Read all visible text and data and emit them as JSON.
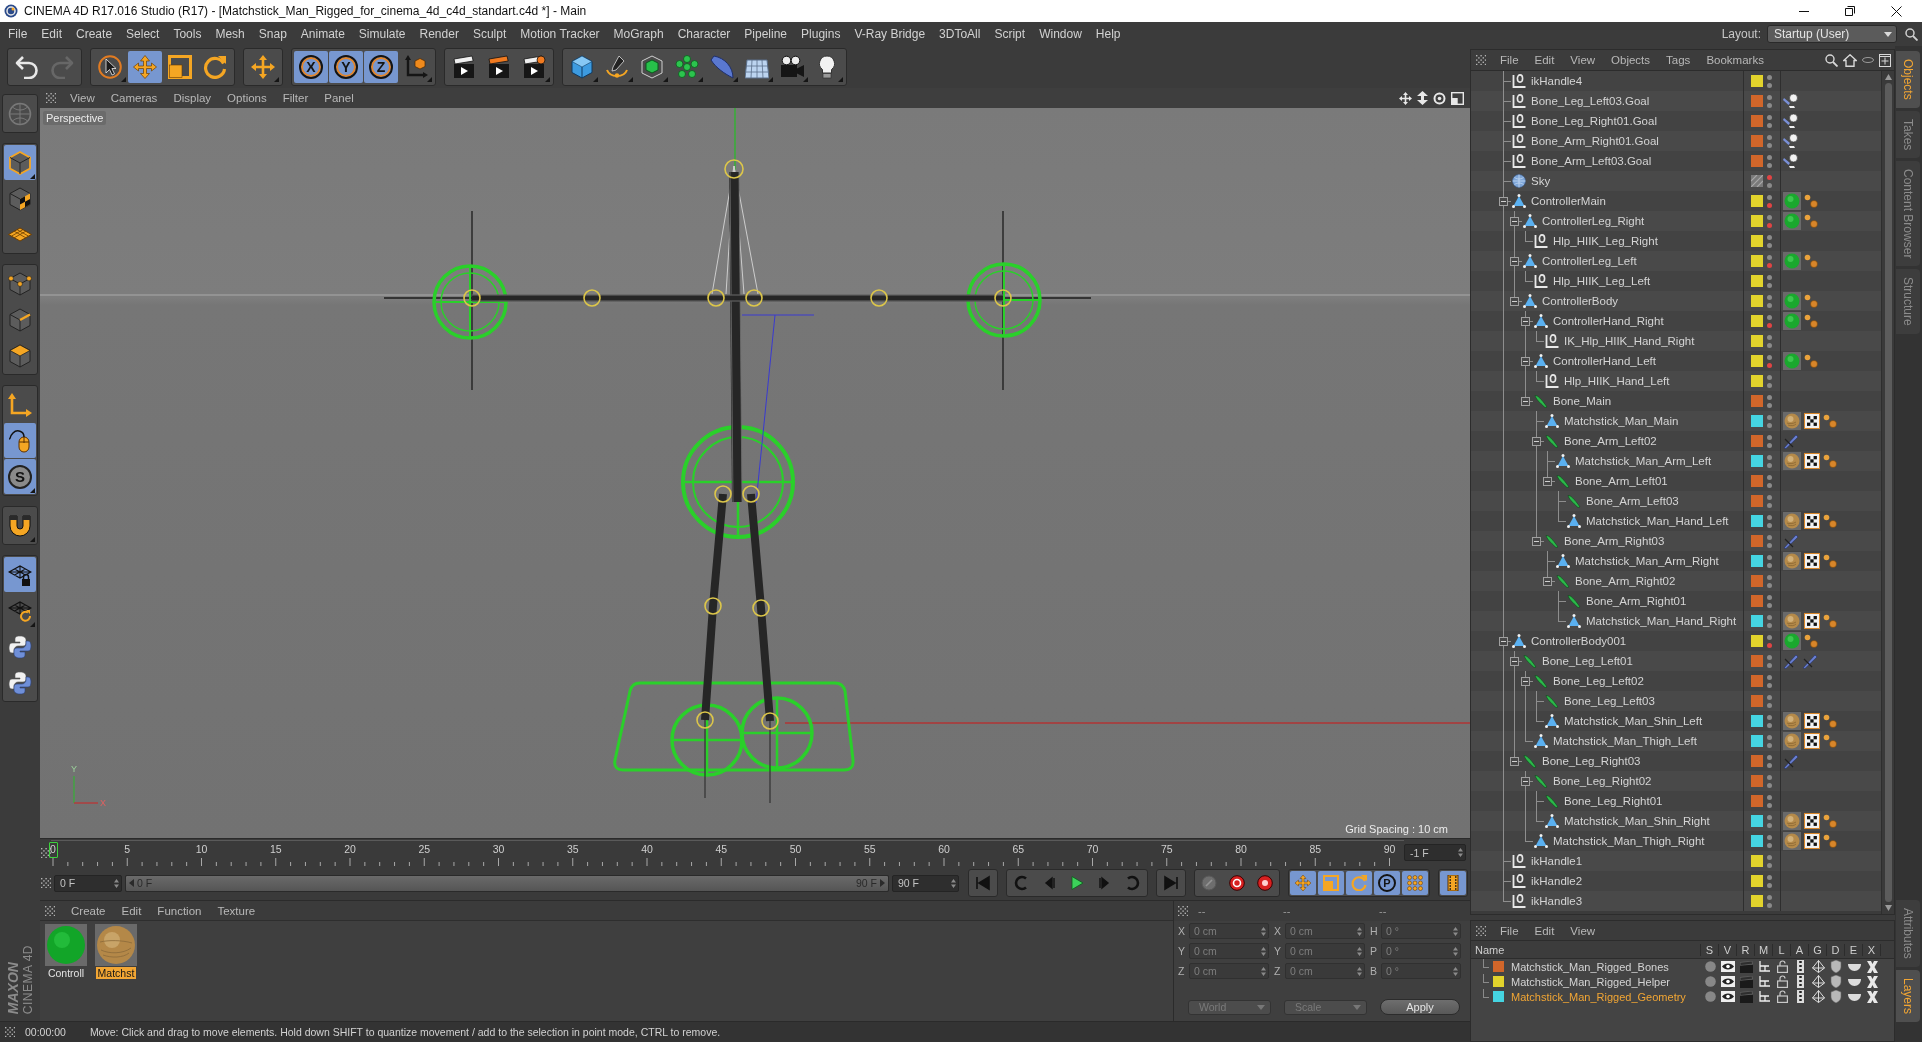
{
  "window": {
    "title": "CINEMA 4D R17.016 Studio (R17) - [Matchstick_Man_Rigged_for_cinema_4d_c4d_standart.c4d *] - Main"
  },
  "menu_bar": {
    "items": [
      "File",
      "Edit",
      "Create",
      "Select",
      "Tools",
      "Mesh",
      "Snap",
      "Animate",
      "Simulate",
      "Render",
      "Sculpt",
      "Motion Tracker",
      "MoGraph",
      "Character",
      "Pipeline",
      "Plugins",
      "V-Ray Bridge",
      "3DToAll",
      "Script",
      "Window",
      "Help"
    ],
    "layout_label": "Layout:",
    "layout_value": "Startup (User)"
  },
  "toolbar": {
    "groups": [
      [
        {
          "kind": "undo",
          "selected": false,
          "submenu": false,
          "disabled": false
        },
        {
          "kind": "redo",
          "selected": false,
          "submenu": false,
          "disabled": true
        }
      ],
      [
        {
          "kind": "select",
          "selected": false,
          "submenu": true,
          "disabled": false
        },
        {
          "kind": "move",
          "selected": true,
          "submenu": false,
          "disabled": false
        },
        {
          "kind": "scale",
          "selected": false,
          "submenu": false,
          "disabled": false
        },
        {
          "kind": "rotate",
          "selected": false,
          "submenu": false,
          "disabled": false
        }
      ],
      [
        {
          "kind": "transform",
          "selected": false,
          "submenu": true,
          "disabled": false
        }
      ],
      [
        {
          "kind": "axis",
          "label": "X",
          "selected": true,
          "submenu": false,
          "disabled": false
        },
        {
          "kind": "axis",
          "label": "Y",
          "selected": true,
          "submenu": false,
          "disabled": false
        },
        {
          "kind": "axis",
          "label": "Z",
          "selected": true,
          "submenu": false,
          "disabled": false
        },
        {
          "kind": "coordinates",
          "selected": false,
          "submenu": true,
          "disabled": false
        }
      ],
      [
        {
          "kind": "renderview",
          "selected": false,
          "submenu": false,
          "disabled": false
        },
        {
          "kind": "render",
          "selected": false,
          "submenu": false,
          "disabled": false
        },
        {
          "kind": "rendersettings",
          "selected": false,
          "submenu": true,
          "disabled": false
        }
      ],
      [
        {
          "kind": "cube",
          "selected": false,
          "submenu": true,
          "disabled": false
        },
        {
          "kind": "pen",
          "selected": false,
          "submenu": true,
          "disabled": false
        },
        {
          "kind": "subdivision",
          "selected": false,
          "submenu": true,
          "disabled": false
        },
        {
          "kind": "cloner",
          "selected": false,
          "submenu": true,
          "disabled": false
        },
        {
          "kind": "deformer",
          "selected": false,
          "submenu": true,
          "disabled": false
        },
        {
          "kind": "floor",
          "selected": false,
          "submenu": true,
          "disabled": false
        },
        {
          "kind": "camera",
          "selected": false,
          "submenu": true,
          "disabled": false
        },
        {
          "kind": "light",
          "selected": false,
          "submenu": true,
          "disabled": false
        }
      ]
    ]
  },
  "left_toolbar": {
    "groups": [
      [
        {
          "kind": "globe",
          "selected": false,
          "submenu": false,
          "disabled": true
        }
      ],
      [
        {
          "kind": "model",
          "selected": true,
          "submenu": true,
          "disabled": false
        },
        {
          "kind": "texture",
          "selected": false,
          "submenu": false,
          "disabled": false
        },
        {
          "kind": "workplane",
          "selected": false,
          "submenu": false,
          "disabled": false
        }
      ],
      [
        {
          "kind": "points",
          "selected": false,
          "submenu": false,
          "disabled": false
        },
        {
          "kind": "edges",
          "selected": false,
          "submenu": false,
          "disabled": false
        },
        {
          "kind": "polygons",
          "selected": false,
          "submenu": false,
          "disabled": false
        }
      ],
      [
        {
          "kind": "axis",
          "selected": false,
          "submenu": false,
          "disabled": false
        },
        {
          "kind": "tweak",
          "selected": true,
          "submenu": false,
          "disabled": false
        },
        {
          "kind": "snap",
          "label": "S",
          "selected": true,
          "submenu": true,
          "disabled": false
        }
      ],
      [
        {
          "kind": "magnet",
          "selected": false,
          "submenu": true,
          "disabled": false
        }
      ],
      [
        {
          "kind": "gridlock",
          "selected": true,
          "submenu": false,
          "disabled": false
        },
        {
          "kind": "gridrotate",
          "selected": false,
          "submenu": true,
          "disabled": false
        },
        {
          "kind": "python",
          "selected": false,
          "submenu": false,
          "disabled": false
        },
        {
          "kind": "python",
          "selected": false,
          "submenu": false,
          "disabled": false
        }
      ]
    ]
  },
  "logo": {
    "brand": "MAXON",
    "product": "CINEMA 4D"
  },
  "viewport": {
    "menu": [
      "View",
      "Cameras",
      "Display",
      "Options",
      "Filter",
      "Panel"
    ],
    "camera": "Perspective",
    "grid_spacing": "Grid Spacing : 10 cm",
    "axis_labels": [
      "Y",
      "X"
    ]
  },
  "timeline": {
    "labels": [
      "0",
      "5",
      "10",
      "15",
      "20",
      "25",
      "30",
      "35",
      "40",
      "45",
      "50",
      "55",
      "60",
      "65",
      "70",
      "75",
      "80",
      "85",
      "90"
    ],
    "level": 0,
    "frame_field": "-1 F"
  },
  "playback": {
    "start": "0 F",
    "range": {
      "start": "0 F",
      "end": "90 F",
      "level": 1
    },
    "end": "90 F",
    "groups": [
      [
        {
          "kind": "first",
          "selected": false,
          "disabled": false
        }
      ],
      [
        {
          "kind": "prevkey",
          "selected": false,
          "disabled": false
        },
        {
          "kind": "prevframe",
          "selected": false,
          "disabled": false
        },
        {
          "kind": "play",
          "selected": false,
          "disabled": false
        },
        {
          "kind": "nextframe",
          "selected": false,
          "disabled": false
        },
        {
          "kind": "nextkey",
          "selected": false,
          "disabled": false
        }
      ],
      [
        {
          "kind": "last",
          "selected": false,
          "disabled": false
        }
      ],
      [
        {
          "kind": "key",
          "selected": false,
          "disabled": true
        },
        {
          "kind": "record",
          "selected": false,
          "disabled": false
        },
        {
          "kind": "autokey",
          "selected": false,
          "disabled": false
        }
      ],
      [
        {
          "kind": "move",
          "selected": true,
          "disabled": false
        },
        {
          "kind": "scale",
          "selected": true,
          "disabled": false
        },
        {
          "kind": "rotate",
          "selected": true,
          "disabled": false
        },
        {
          "kind": "param",
          "label": "P",
          "selected": true,
          "disabled": false
        },
        {
          "kind": "points",
          "selected": true,
          "disabled": false
        }
      ],
      [
        {
          "kind": "timeline",
          "selected": true,
          "disabled": false
        }
      ]
    ]
  },
  "materials": {
    "menu": [
      "Create",
      "Edit",
      "Function",
      "Texture"
    ],
    "items": [
      {
        "name": "Controll",
        "kind": "glossy",
        "selected": false
      },
      {
        "name": "Matchst",
        "kind": "wood",
        "selected": true
      }
    ]
  },
  "coordinates": {
    "headers": [
      "--",
      "--",
      "--"
    ],
    "rows": [
      [
        {
          "label": "X",
          "value": "0 cm"
        },
        {
          "label": "X",
          "value": "0 cm"
        },
        {
          "label": "H",
          "value": "0 °"
        }
      ],
      [
        {
          "label": "Y",
          "value": "0 cm"
        },
        {
          "label": "Y",
          "value": "0 cm"
        },
        {
          "label": "P",
          "value": "0 °"
        }
      ],
      [
        {
          "label": "Z",
          "value": "0 cm"
        },
        {
          "label": "Z",
          "value": "0 cm"
        },
        {
          "label": "B",
          "value": "0 °"
        }
      ]
    ],
    "dropdowns": [
      "World",
      "Scale"
    ],
    "apply": "Apply"
  },
  "status_bar": {
    "time": "00:00:00",
    "message": "Move: Click and drag to move elements. Hold down SHIFT to quantize movement / add to the selection in point mode, CTRL to remove."
  },
  "object_manager": {
    "menu": [
      "File",
      "Edit",
      "View",
      "Objects",
      "Tags",
      "Bookmarks"
    ],
    "objects": [
      {
        "name": "ikHandle4",
        "kind": "null",
        "color": "#e2d32c",
        "hidden_in_editor": false,
        "hidden_in_render": false
      },
      {
        "name": "Bone_Leg_Left03.Goal",
        "kind": "null",
        "color": "#d1662a",
        "hidden_in_editor": false,
        "hidden_in_render": false,
        "tags": [
          {
            "kind": "goal"
          }
        ]
      },
      {
        "name": "Bone_Leg_Right01.Goal",
        "kind": "null",
        "color": "#d1662a",
        "hidden_in_editor": false,
        "hidden_in_render": false,
        "tags": [
          {
            "kind": "goal"
          }
        ]
      },
      {
        "name": "Bone_Arm_Right01.Goal",
        "kind": "null",
        "color": "#d1662a",
        "hidden_in_editor": false,
        "hidden_in_render": false,
        "tags": [
          {
            "kind": "goal"
          }
        ]
      },
      {
        "name": "Bone_Arm_Left03.Goal",
        "kind": "null",
        "color": "#d1662a",
        "hidden_in_editor": false,
        "hidden_in_render": false,
        "tags": [
          {
            "kind": "goal"
          }
        ]
      },
      {
        "name": "Sky",
        "kind": "sky",
        "hidden_in_editor": true,
        "hidden_in_render": false
      },
      {
        "name": "ControllerMain",
        "kind": "polygon",
        "color": "#e2d32c",
        "hidden_in_editor": false,
        "hidden_in_render": true,
        "tags": [
          {
            "kind": "green-material"
          },
          {
            "kind": "dots"
          }
        ],
        "expanded": true,
        "children": [
          {
            "name": "ControllerLeg_Right",
            "kind": "polygon",
            "color": "#e2d32c",
            "hidden_in_editor": false,
            "hidden_in_render": true,
            "tags": [
              {
                "kind": "green-material"
              },
              {
                "kind": "dots"
              }
            ],
            "expanded": true,
            "children": [
              {
                "name": "Hlp_HIIK_Leg_Right",
                "kind": "null",
                "color": "#e2d32c",
                "hidden_in_editor": false,
                "hidden_in_render": false
              }
            ]
          },
          {
            "name": "ControllerLeg_Left",
            "kind": "polygon",
            "color": "#e2d32c",
            "hidden_in_editor": false,
            "hidden_in_render": true,
            "tags": [
              {
                "kind": "green-material"
              },
              {
                "kind": "dots"
              }
            ],
            "expanded": true,
            "children": [
              {
                "name": "Hlp_HIIK_Leg_Left",
                "kind": "null",
                "color": "#e2d32c",
                "hidden_in_editor": false,
                "hidden_in_render": false
              }
            ]
          },
          {
            "name": "ControllerBody",
            "kind": "polygon",
            "color": "#e2d32c",
            "hidden_in_editor": false,
            "hidden_in_render": false,
            "tags": [
              {
                "kind": "green-material"
              },
              {
                "kind": "dots"
              }
            ],
            "expanded": true,
            "children": [
              {
                "name": "ControllerHand_Right",
                "kind": "polygon",
                "color": "#e2d32c",
                "hidden_in_editor": false,
                "hidden_in_render": true,
                "tags": [
                  {
                    "kind": "green-material"
                  },
                  {
                    "kind": "dots"
                  }
                ],
                "expanded": true,
                "children": [
                  {
                    "name": "IK_Hlp_HIIK_Hand_Right",
                    "kind": "null",
                    "color": "#e2d32c",
                    "hidden_in_editor": false,
                    "hidden_in_render": false
                  }
                ]
              },
              {
                "name": "ControllerHand_Left",
                "kind": "polygon",
                "color": "#e2d32c",
                "hidden_in_editor": false,
                "hidden_in_render": true,
                "tags": [
                  {
                    "kind": "green-material"
                  },
                  {
                    "kind": "dots"
                  }
                ],
                "expanded": true,
                "children": [
                  {
                    "name": "Hlp_HIIK_Hand_Left",
                    "kind": "null",
                    "color": "#e2d32c",
                    "hidden_in_editor": false,
                    "hidden_in_render": false
                  }
                ]
              },
              {
                "name": "Bone_Main",
                "kind": "bone",
                "color": "#d1662a",
                "hidden_in_editor": false,
                "hidden_in_render": false,
                "expanded": true,
                "children": [
                  {
                    "name": "Matchstick_Man_Main",
                    "kind": "polygon",
                    "color": "#45d4e1",
                    "hidden_in_editor": false,
                    "hidden_in_render": false,
                    "tags": [
                      {
                        "kind": "wood-material"
                      },
                      {
                        "kind": "checker"
                      },
                      {
                        "kind": "dots"
                      }
                    ]
                  },
                  {
                    "name": "Bone_Arm_Left02",
                    "kind": "bone",
                    "color": "#d1662a",
                    "hidden_in_editor": false,
                    "hidden_in_render": false,
                    "tags": [
                      {
                        "kind": "ik"
                      }
                    ],
                    "expanded": true,
                    "children": [
                      {
                        "name": "Matchstick_Man_Arm_Left",
                        "kind": "polygon",
                        "color": "#45d4e1",
                        "hidden_in_editor": false,
                        "hidden_in_render": false,
                        "tags": [
                          {
                            "kind": "wood-material"
                          },
                          {
                            "kind": "checker"
                          },
                          {
                            "kind": "dots"
                          }
                        ]
                      },
                      {
                        "name": "Bone_Arm_Left01",
                        "kind": "bone",
                        "color": "#d1662a",
                        "hidden_in_editor": false,
                        "hidden_in_render": false,
                        "expanded": true,
                        "children": [
                          {
                            "name": "Bone_Arm_Left03",
                            "kind": "bone",
                            "color": "#d1662a",
                            "hidden_in_editor": false,
                            "hidden_in_render": false
                          },
                          {
                            "name": "Matchstick_Man_Hand_Left",
                            "kind": "polygon",
                            "color": "#45d4e1",
                            "hidden_in_editor": false,
                            "hidden_in_render": false,
                            "tags": [
                              {
                                "kind": "wood-material"
                              },
                              {
                                "kind": "checker"
                              },
                              {
                                "kind": "dots"
                              }
                            ]
                          }
                        ]
                      }
                    ]
                  },
                  {
                    "name": "Bone_Arm_Right03",
                    "kind": "bone",
                    "color": "#d1662a",
                    "hidden_in_editor": false,
                    "hidden_in_render": false,
                    "tags": [
                      {
                        "kind": "ik"
                      }
                    ],
                    "expanded": true,
                    "children": [
                      {
                        "name": "Matchstick_Man_Arm_Right",
                        "kind": "polygon",
                        "color": "#45d4e1",
                        "hidden_in_editor": false,
                        "hidden_in_render": false,
                        "tags": [
                          {
                            "kind": "wood-material"
                          },
                          {
                            "kind": "checker"
                          },
                          {
                            "kind": "dots"
                          }
                        ]
                      },
                      {
                        "name": "Bone_Arm_Right02",
                        "kind": "bone",
                        "color": "#d1662a",
                        "hidden_in_editor": false,
                        "hidden_in_render": false,
                        "expanded": true,
                        "children": [
                          {
                            "name": "Bone_Arm_Right01",
                            "kind": "bone",
                            "color": "#d1662a",
                            "hidden_in_editor": false,
                            "hidden_in_render": false
                          },
                          {
                            "name": "Matchstick_Man_Hand_Right",
                            "kind": "polygon",
                            "color": "#45d4e1",
                            "hidden_in_editor": false,
                            "hidden_in_render": false,
                            "tags": [
                              {
                                "kind": "wood-material"
                              },
                              {
                                "kind": "checker"
                              },
                              {
                                "kind": "dots"
                              }
                            ]
                          }
                        ]
                      }
                    ]
                  }
                ]
              }
            ]
          }
        ]
      },
      {
        "name": "ControllerBody001",
        "kind": "polygon",
        "color": "#e2d32c",
        "hidden_in_editor": false,
        "hidden_in_render": true,
        "tags": [
          {
            "kind": "green-material"
          },
          {
            "kind": "dots"
          }
        ],
        "expanded": true,
        "children": [
          {
            "name": "Bone_Leg_Left01",
            "kind": "bone",
            "color": "#d1662a",
            "hidden_in_editor": false,
            "hidden_in_render": false,
            "tags": [
              {
                "kind": "ik"
              },
              {
                "kind": "ik"
              }
            ],
            "expanded": true,
            "children": [
              {
                "name": "Bone_Leg_Left02",
                "kind": "bone",
                "color": "#d1662a",
                "hidden_in_editor": false,
                "hidden_in_render": false,
                "expanded": true,
                "children": [
                  {
                    "name": "Bone_Leg_Left03",
                    "kind": "bone",
                    "color": "#d1662a",
                    "hidden_in_editor": false,
                    "hidden_in_render": false
                  },
                  {
                    "name": "Matchstick_Man_Shin_Left",
                    "kind": "polygon",
                    "color": "#45d4e1",
                    "hidden_in_editor": false,
                    "hidden_in_render": false,
                    "tags": [
                      {
                        "kind": "wood-material"
                      },
                      {
                        "kind": "checker"
                      },
                      {
                        "kind": "dots"
                      }
                    ]
                  }
                ]
              },
              {
                "name": "Matchstick_Man_Thigh_Left",
                "kind": "polygon",
                "color": "#45d4e1",
                "hidden_in_editor": false,
                "hidden_in_render": false,
                "tags": [
                  {
                    "kind": "wood-material"
                  },
                  {
                    "kind": "checker"
                  },
                  {
                    "kind": "dots"
                  }
                ]
              }
            ]
          },
          {
            "name": "Bone_Leg_Right03",
            "kind": "bone",
            "color": "#d1662a",
            "hidden_in_editor": false,
            "hidden_in_render": false,
            "tags": [
              {
                "kind": "ik"
              }
            ],
            "expanded": true,
            "children": [
              {
                "name": "Bone_Leg_Right02",
                "kind": "bone",
                "color": "#d1662a",
                "hidden_in_editor": false,
                "hidden_in_render": false,
                "expanded": true,
                "children": [
                  {
                    "name": "Bone_Leg_Right01",
                    "kind": "bone",
                    "color": "#d1662a",
                    "hidden_in_editor": false,
                    "hidden_in_render": false
                  },
                  {
                    "name": "Matchstick_Man_Shin_Right",
                    "kind": "polygon",
                    "color": "#45d4e1",
                    "hidden_in_editor": false,
                    "hidden_in_render": false,
                    "tags": [
                      {
                        "kind": "wood-material"
                      },
                      {
                        "kind": "checker"
                      },
                      {
                        "kind": "dots"
                      }
                    ]
                  }
                ]
              },
              {
                "name": "Matchstick_Man_Thigh_Right",
                "kind": "polygon",
                "color": "#45d4e1",
                "hidden_in_editor": false,
                "hidden_in_render": false,
                "tags": [
                  {
                    "kind": "wood-material"
                  },
                  {
                    "kind": "checker"
                  },
                  {
                    "kind": "dots"
                  }
                ]
              }
            ]
          }
        ]
      },
      {
        "name": "ikHandle1",
        "kind": "null",
        "color": "#e2d32c",
        "hidden_in_editor": false,
        "hidden_in_render": false
      },
      {
        "name": "ikHandle2",
        "kind": "null",
        "color": "#e2d32c",
        "hidden_in_editor": false,
        "hidden_in_render": false
      },
      {
        "name": "ikHandle3",
        "kind": "null",
        "color": "#e2d32c",
        "hidden_in_editor": false,
        "hidden_in_render": false
      }
    ]
  },
  "layer_manager": {
    "menu": [
      "File",
      "Edit",
      "View"
    ],
    "columns": [
      "Name",
      "S",
      "V",
      "R",
      "M",
      "L",
      "A",
      "G",
      "D",
      "E",
      "X"
    ],
    "layers": [
      {
        "name": "Matchstick_Man_Rigged_Bones",
        "color": "#d1662a",
        "selected": false
      },
      {
        "name": "Matchstick_Man_Rigged_Helper",
        "color": "#e2d32c",
        "selected": false
      },
      {
        "name": "Matchstick_Man_Rigged_Geometry",
        "color": "#45d4e1",
        "selected": true
      }
    ]
  },
  "side_tabs": {
    "top": [
      {
        "label": "Objects",
        "selected": true
      },
      {
        "label": "Takes",
        "selected": false
      },
      {
        "label": "Content Browser",
        "selected": false
      },
      {
        "label": "Structure",
        "selected": false
      }
    ],
    "bottom": [
      {
        "label": "Attributes",
        "selected": false
      },
      {
        "label": "Layers",
        "selected": true
      }
    ]
  }
}
